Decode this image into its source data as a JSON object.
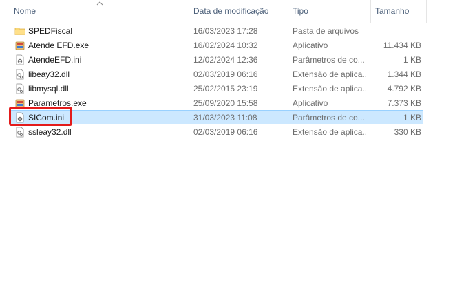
{
  "columns": {
    "name": "Nome",
    "date": "Data de modificação",
    "type": "Tipo",
    "size": "Tamanho"
  },
  "files": [
    {
      "name": "SPEDFiscal",
      "date": "16/03/2023 17:28",
      "type": "Pasta de arquivos",
      "size": "",
      "icon": "folder-icon"
    },
    {
      "name": "Atende EFD.exe",
      "date": "16/02/2024 10:32",
      "type": "Aplicativo",
      "size": "11.434 KB",
      "icon": "application-icon"
    },
    {
      "name": "AtendeEFD.ini",
      "date": "12/02/2024 12:36",
      "type": "Parâmetros de co...",
      "size": "1 KB",
      "icon": "settings-file-icon"
    },
    {
      "name": "libeay32.dll",
      "date": "02/03/2019 06:16",
      "type": "Extensão de aplica...",
      "size": "1.344 KB",
      "icon": "dll-file-icon"
    },
    {
      "name": "libmysql.dll",
      "date": "25/02/2015 23:19",
      "type": "Extensão de aplica...",
      "size": "4.792 KB",
      "icon": "dll-file-icon"
    },
    {
      "name": "Parametros.exe",
      "date": "25/09/2020 15:58",
      "type": "Aplicativo",
      "size": "7.373 KB",
      "icon": "application-icon"
    },
    {
      "name": "SICom.ini",
      "date": "31/03/2023 11:08",
      "type": "Parâmetros de co...",
      "size": "1 KB",
      "icon": "settings-file-icon",
      "selected": true
    },
    {
      "name": "ssleay32.dll",
      "date": "02/03/2019 06:16",
      "type": "Extensão de aplica...",
      "size": "330 KB",
      "icon": "dll-file-icon"
    }
  ],
  "colors": {
    "selection_bg": "#cce8ff",
    "selection_border": "#99d1ff",
    "highlight": "#e31b1b",
    "header_text": "#4c607a"
  }
}
